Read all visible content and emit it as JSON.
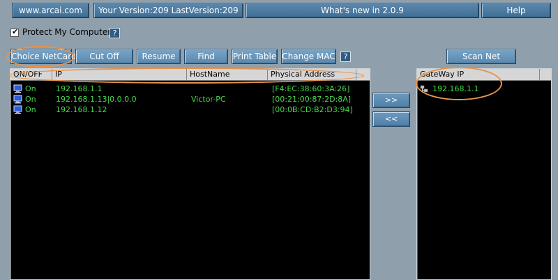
{
  "topbar": {
    "site": "www.arcai.com",
    "version": "Your Version:209 LastVersion:209",
    "whats_new": "What's new in 2.0.9",
    "help": "Help"
  },
  "protect": {
    "label": "Protect My Computer",
    "checked": true,
    "help": "?"
  },
  "toolbar": {
    "choice_netcard": "Choice NetCard",
    "cut_off": "Cut Off",
    "resume": "Resume",
    "find": "Find",
    "print_table": "Print Table",
    "change_mac": "Change MAC",
    "help": "?",
    "scan_net": "Scan Net"
  },
  "host_table": {
    "columns": [
      "ON/OFF",
      "IP",
      "HostName",
      "Physical Address"
    ],
    "rows": [
      {
        "status": "On",
        "ip": "192.168.1.1",
        "hostname": "",
        "mac": "[F4:EC:38:60:3A:26]"
      },
      {
        "status": "On",
        "ip": "192.168.1.13|0.0.0.0",
        "hostname": "Victor-PC",
        "mac": "[00:21:00:87:2D:8A]"
      },
      {
        "status": "On",
        "ip": "192.168.1.12",
        "hostname": "",
        "mac": "[00:0B:CD:B2:D3:94]"
      }
    ]
  },
  "move": {
    "right": ">>",
    "left": "<<"
  },
  "gateway": {
    "header": "GateWay IP",
    "items": [
      "192.168.1.1"
    ]
  },
  "colors": {
    "background": "#8f9fab",
    "list_bg": "#000000",
    "list_text": "#49d84b",
    "button": "#5a88ad",
    "highlight": "#e8934a"
  }
}
